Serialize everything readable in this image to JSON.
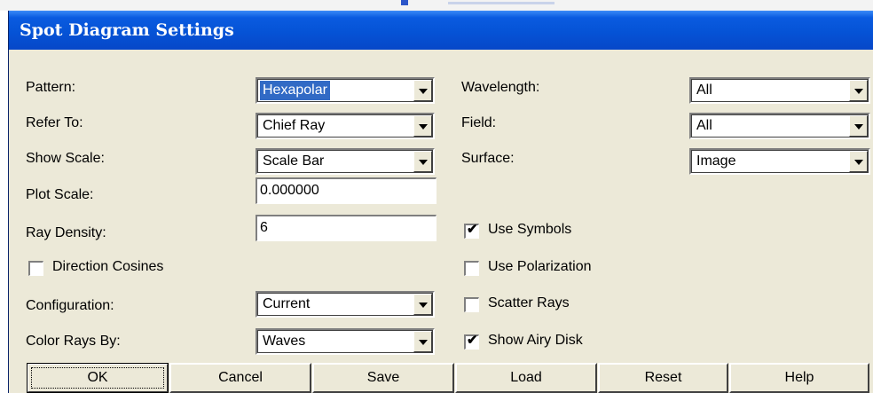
{
  "dialog": {
    "title": "Spot Diagram Settings"
  },
  "left": {
    "pattern": {
      "label": "Pattern:",
      "value": "Hexapolar"
    },
    "refer_to": {
      "label": "Refer To:",
      "value": "Chief Ray"
    },
    "show_scale": {
      "label": "Show Scale:",
      "value": "Scale Bar"
    },
    "plot_scale": {
      "label": "Plot Scale:",
      "value": "0.000000"
    },
    "ray_density": {
      "label": "Ray Density:",
      "value": "6"
    },
    "direction_cosines": {
      "label": "Direction Cosines",
      "checked": false
    },
    "configuration": {
      "label": "Configuration:",
      "value": "Current"
    },
    "color_rays_by": {
      "label": "Color Rays By:",
      "value": "Waves"
    }
  },
  "right": {
    "wavelength": {
      "label": "Wavelength:",
      "value": "All"
    },
    "field": {
      "label": "Field:",
      "value": "All"
    },
    "surface": {
      "label": "Surface:",
      "value": "Image"
    },
    "use_symbols": {
      "label": "Use Symbols",
      "checked": true,
      "mark": "✔"
    },
    "use_polarization": {
      "label": "Use Polarization",
      "checked": false,
      "mark": ""
    },
    "scatter_rays": {
      "label": "Scatter Rays",
      "checked": false,
      "mark": ""
    },
    "show_airy_disk": {
      "label": "Show Airy Disk",
      "checked": true,
      "mark": "✔"
    }
  },
  "buttons": {
    "ok": "OK",
    "cancel": "Cancel",
    "save": "Save",
    "load": "Load",
    "reset": "Reset",
    "help": "Help"
  },
  "colors": {
    "titlebar": "#0553d6",
    "dialog_bg": "#ece9d8",
    "selection": "#316ac5"
  }
}
